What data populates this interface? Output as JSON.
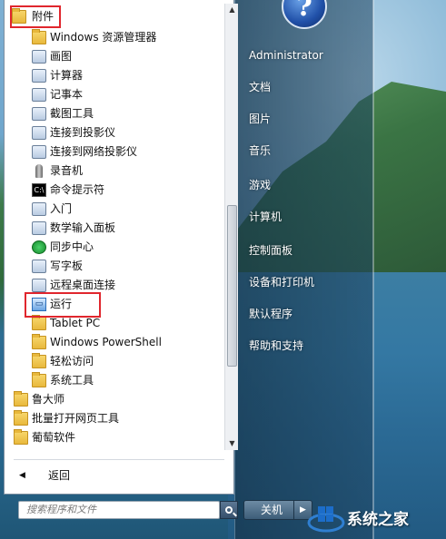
{
  "left_menu": {
    "header_folder": "附件",
    "items": [
      {
        "label": "Windows 资源管理器",
        "icon": "explorer-icon"
      },
      {
        "label": "画图",
        "icon": "paint-icon"
      },
      {
        "label": "计算器",
        "icon": "calculator-icon"
      },
      {
        "label": "记事本",
        "icon": "notepad-icon"
      },
      {
        "label": "截图工具",
        "icon": "snipping-tool-icon"
      },
      {
        "label": "连接到投影仪",
        "icon": "projector-icon"
      },
      {
        "label": "连接到网络投影仪",
        "icon": "network-projector-icon"
      },
      {
        "label": "录音机",
        "icon": "microphone-icon"
      },
      {
        "label": "命令提示符",
        "icon": "command-prompt-icon"
      },
      {
        "label": "入门",
        "icon": "getting-started-icon"
      },
      {
        "label": "数学输入面板",
        "icon": "math-input-icon"
      },
      {
        "label": "同步中心",
        "icon": "sync-center-icon"
      },
      {
        "label": "写字板",
        "icon": "wordpad-icon"
      },
      {
        "label": "远程桌面连接",
        "icon": "remote-desktop-icon"
      },
      {
        "label": "运行",
        "icon": "run-icon"
      }
    ],
    "subfolders": [
      {
        "label": "Tablet PC"
      },
      {
        "label": "Windows PowerShell"
      },
      {
        "label": "轻松访问"
      },
      {
        "label": "系统工具"
      }
    ],
    "top_folders": [
      {
        "label": "鲁大师"
      },
      {
        "label": "批量打开网页工具"
      },
      {
        "label": "葡萄软件"
      }
    ],
    "back_label": "返回",
    "search_placeholder": "搜索程序和文件"
  },
  "right_menu": {
    "items": [
      {
        "label": "Administrator"
      },
      {
        "label": "文档"
      },
      {
        "label": "图片"
      },
      {
        "label": "音乐"
      },
      {
        "label": "游戏"
      },
      {
        "label": "计算机"
      },
      {
        "label": "控制面板"
      },
      {
        "label": "设备和打印机"
      },
      {
        "label": "默认程序"
      },
      {
        "label": "帮助和支持"
      }
    ],
    "shutdown_label": "关机",
    "user_pic_glyph": "?"
  },
  "watermark": {
    "text": "系统之家"
  },
  "colors": {
    "highlight": "#e0262d",
    "folder": "#e8b83c"
  }
}
